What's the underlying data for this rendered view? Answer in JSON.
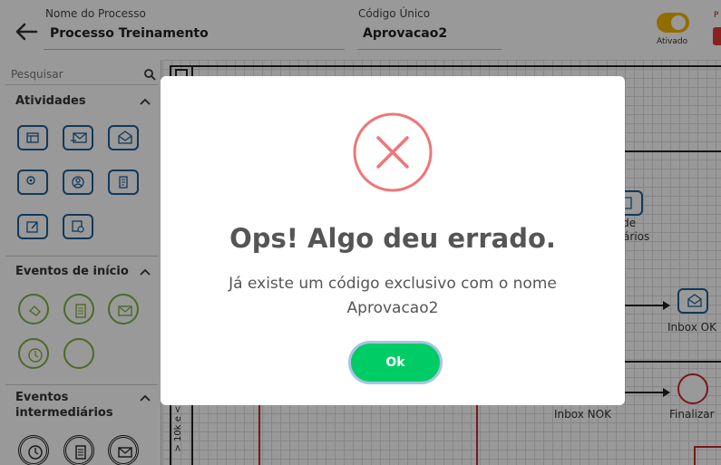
{
  "header": {
    "process_name_label": "Nome do Processo",
    "process_name_value": "Processo Treinamento",
    "unique_code_label": "Código Único",
    "unique_code_value": "Aprovacao2",
    "toggle_label": "Ativado",
    "toggle_on": true,
    "right_chip_label": "P"
  },
  "sidebar": {
    "search_placeholder": "Pesquisar",
    "sections": {
      "activities": {
        "title": "Atividades"
      },
      "start_events": {
        "title": "Eventos de início"
      },
      "intermediate_events": {
        "title_line1": "Eventos",
        "title_line2": "intermediários"
      }
    }
  },
  "canvas": {
    "lane_label": "> 10k e < 5",
    "labels": {
      "task_partial_line1": "a de",
      "task_partial_line2": "atários",
      "inbox_ok": "Inbox OK",
      "inbox_nok": "Inbox NOK",
      "finalizar": "Finalizar"
    }
  },
  "modal": {
    "title": "Ops! Algo deu errado.",
    "message_line1": "Já existe um código exclusivo com o nome",
    "message_line2": "Aprovacao2",
    "ok_label": "Ok"
  },
  "colors": {
    "accent_yellow": "#f2b400",
    "activity_blue": "#1d5f96",
    "start_green": "#7cb342",
    "error_red": "#ef7676",
    "ok_green": "#00cc66"
  }
}
